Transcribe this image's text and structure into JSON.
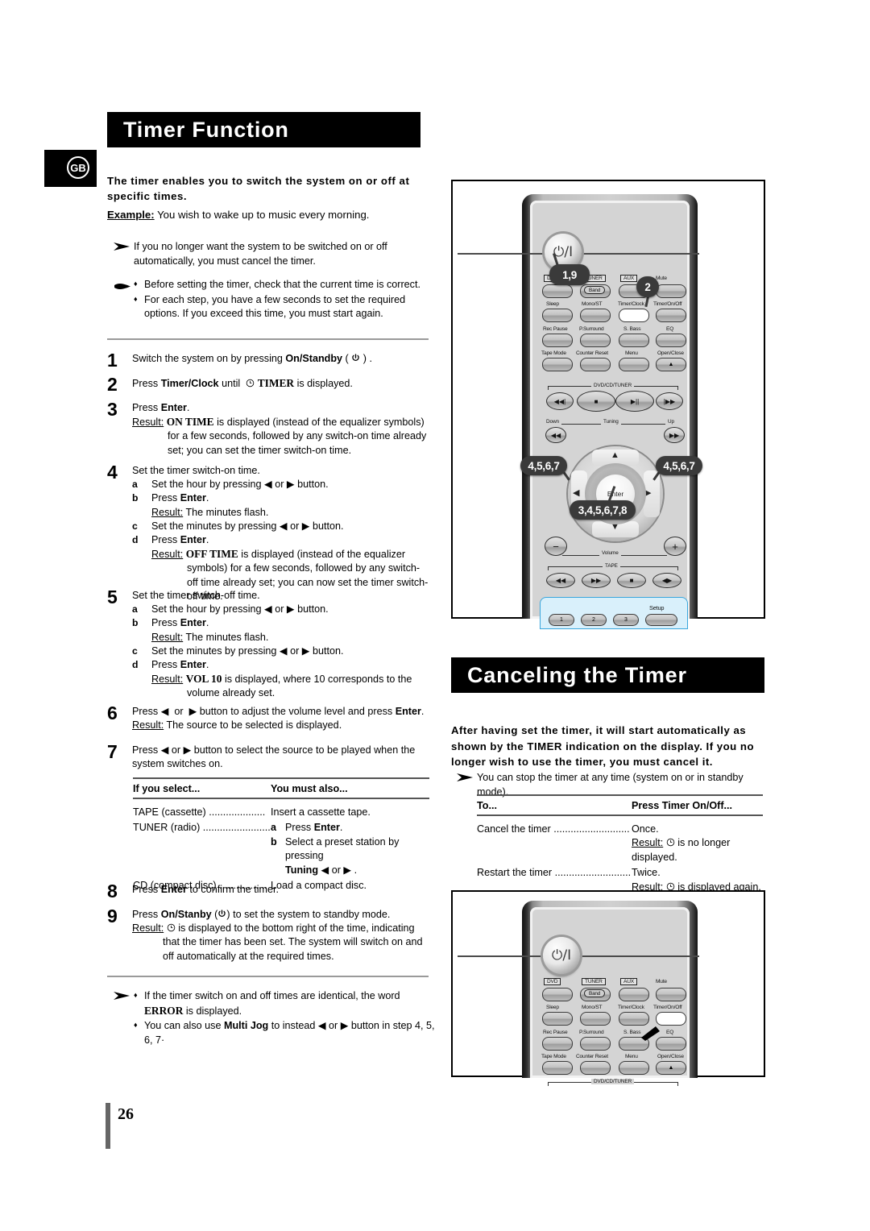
{
  "locale_badge": "GB",
  "page_number": "26",
  "sections": {
    "timer_function": {
      "title": "Timer Function",
      "intro_bold": "The timer enables you to switch the system on or off at specific times.",
      "example_label": "Example:",
      "example_text": " You wish to wake up to music every morning.",
      "note_cancel": "If you no longer want the system to be switched on or off automatically, you must cancel the timer.",
      "tips": [
        "Before setting the timer, check that the current time is correct.",
        "For each step, you have a few seconds to set the required options. If you exceed this time, you must start again."
      ]
    },
    "canceling_timer": {
      "title": "Canceling the Timer",
      "intro_bold": "After having set the timer, it will start automatically as shown by the TIMER indication on the display. If you no longer wish to use the timer, you must cancel it.",
      "note_stop": "You can stop the timer at any time (system on or in standby mode)."
    }
  },
  "steps": [
    {
      "num": "1",
      "lines": [
        {
          "text": "Switch the system on by pressing ",
          "bold": "On/Standby",
          "suffix": " (  ) ."
        }
      ]
    },
    {
      "num": "2",
      "lines": [
        {
          "text": "Press ",
          "bold": "Timer/Clock",
          "suffix": " until    TIMER is displayed."
        }
      ]
    },
    {
      "num": "3",
      "press": "Press ",
      "press_bold": "Enter",
      "press_suffix": ".",
      "result_label": "Result:",
      "result_text": " ON TIME is displayed (instead of the equalizer symbols) for a few seconds, followed by any switch-on time already set; you can set the timer switch-on time.",
      "result_caps": "ON TIME"
    },
    {
      "num": "4",
      "title": "Set the timer switch-on time.",
      "subs": [
        {
          "letter": "a",
          "text": "Set the hour by pressing  ◀  or  ▶ button."
        },
        {
          "letter": "b",
          "text_pre": "Press ",
          "bold": "Enter",
          "text_post": ".",
          "result_label": "Result:",
          "result": " The minutes flash."
        },
        {
          "letter": "c",
          "text": "Set the minutes by pressing  ◀  or  ▶ button."
        },
        {
          "letter": "d",
          "text_pre": "Press ",
          "bold": "Enter",
          "text_post": ".",
          "result_label": "Result:",
          "result_caps": "OFF TIME",
          "result": " is displayed (instead of the equalizer symbols) for a few seconds, followed by any switch-off time already set; you can now set the timer switch-off time."
        }
      ]
    },
    {
      "num": "5",
      "title": "Set the timer switch-off time.",
      "subs": [
        {
          "letter": "a",
          "text": "Set the hour by pressing  ◀  or  ▶ button."
        },
        {
          "letter": "b",
          "text_pre": "Press ",
          "bold": "Enter",
          "text_post": ".",
          "result_label": "Result:",
          "result": " The minutes flash."
        },
        {
          "letter": "c",
          "text": "Set the minutes by pressing  ◀  or  ▶ button."
        },
        {
          "letter": "d",
          "text_pre": "Press ",
          "bold": "Enter",
          "text_post": ".",
          "result_label": "Result:",
          "result_caps": "VOL 10",
          "result": " is displayed, where 10 corresponds to the volume already set."
        }
      ]
    },
    {
      "num": "6",
      "line": "Press ◀  or  ▶ button to adjust the volume level and press Enter.",
      "result_label": "Result:",
      "result": " The source to be selected is displayed."
    },
    {
      "num": "7",
      "line": "Press ◀  or  ▶ button to select the source to be played when the system switches on."
    },
    {
      "num": "8",
      "line_pre": "Press ",
      "bold": "Enter",
      "line_post": " to confirm the timer."
    },
    {
      "num": "9",
      "line_pre": "Press ",
      "bold": "On/Stanby",
      "line_post": " (   ) to set the system to standby mode.",
      "result_label": "Result:",
      "result": "   is displayed to the bottom right of the time, indicating that the timer has been set. The system will switch on and off automatically at the required times."
    }
  ],
  "source_table": {
    "header": [
      "If you select...",
      "You must also..."
    ],
    "rows": [
      {
        "source": "TAPE (cassette)",
        "dots": " ....................",
        "action": "Insert a cassette tape."
      },
      {
        "source": "TUNER (radio)",
        "dots": " ........................",
        "action_subs": [
          {
            "letter": "a",
            "pre": "Press ",
            "bold": "Enter",
            "post": "."
          },
          {
            "letter": "b",
            "pre": "Select a preset station by pressing ",
            "bold2": "Tuning",
            "post2": " ◀   or  ▶ ."
          }
        ]
      },
      {
        "source": "CD (compact disc)",
        "dots": " .................",
        "action": "Load a compact disc."
      }
    ]
  },
  "cancel_table": {
    "header": [
      "To...",
      "Press Timer On/Off..."
    ],
    "rows": [
      {
        "label": "Cancel the timer",
        "dots": " ...........................",
        "value": "Once.",
        "result_label": "Result:",
        "result": "   is no longer displayed."
      },
      {
        "label": "Restart the timer",
        "dots": " ..............................",
        "value": "Twice.",
        "result_label": "Result:",
        "result": "  is displayed again."
      }
    ]
  },
  "footnotes": [
    {
      "pre": "If the timer switch on and off times are identical, the word ",
      "caps": "ERROR",
      "post": " is displayed."
    },
    {
      "pre": "You can also use ",
      "bold": "Multi Jog",
      "post": " to instead ◀  or  ▶  button in step 4, 5, 6, 7·"
    }
  ],
  "remote_top": {
    "power_label": "⏻/I",
    "buttons_row1": [
      {
        "label": "DVD",
        "style": "box"
      },
      {
        "label": "TUNER",
        "style": "box",
        "sub": "Band"
      },
      {
        "label": "AUX",
        "style": "box"
      },
      {
        "label": "Mute",
        "style": "plain"
      }
    ],
    "buttons_row2": [
      "Sleep",
      "Mono/ST",
      "Timer/Clock",
      "Timer/On/Off"
    ],
    "buttons_row3": [
      "Rec Pause",
      "P.Surround",
      "S. Bass",
      "EQ"
    ],
    "buttons_row4": [
      "Tape Mode",
      "Counter Reset",
      "Menu",
      "Open/Close"
    ],
    "transport_group": "DVD/CD/TUNER",
    "tuning_labels": {
      "left": "Down",
      "center": "Tuning",
      "right": "Up"
    },
    "dpad_center": "Enter",
    "volume_label": "Volume",
    "tape_group": "TAPE",
    "numpad": [
      "1",
      "2",
      "3"
    ],
    "setup_label": "Setup",
    "callouts": [
      {
        "text": "1,9",
        "target": "power-button"
      },
      {
        "text": "2",
        "target": "timer-clock-button"
      },
      {
        "text": "4,5,6,7",
        "target": "dpad-left"
      },
      {
        "text": "4,5,6,7",
        "target": "dpad-right"
      },
      {
        "text": "3,4,5,6,7,8",
        "target": "enter-button"
      }
    ]
  },
  "remote_bottom": {
    "power_label": "⏻/I",
    "buttons_row1": [
      {
        "label": "DVD",
        "style": "box"
      },
      {
        "label": "TUNER",
        "style": "box",
        "sub": "Band"
      },
      {
        "label": "AUX",
        "style": "box"
      },
      {
        "label": "Mute",
        "style": "plain"
      }
    ],
    "buttons_row2": [
      "Sleep",
      "Mono/ST",
      "Timer/Clock",
      "Timer/On/Off"
    ],
    "buttons_row3": [
      "Rec Pause",
      "P.Surround",
      "S. Bass",
      "EQ"
    ],
    "buttons_row4": [
      "Tape Mode",
      "Counter Reset",
      "Menu",
      "Open/Close"
    ],
    "transport_group": "DVD/CD/TUNER",
    "highlight_button": "Timer/On/Off"
  }
}
